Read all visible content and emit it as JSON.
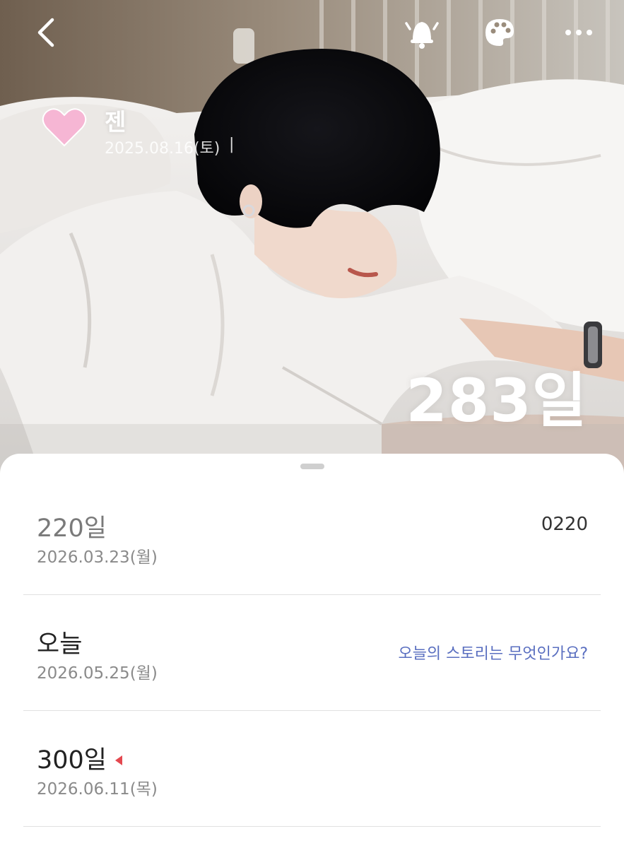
{
  "header": {
    "back_icon": "chevron-left-icon",
    "bell_icon": "bell-icon",
    "palette_icon": "palette-icon",
    "more_icon": "more-horizontal-icon"
  },
  "profile": {
    "icon": "heart-icon",
    "heart_color": "#f6b6d4",
    "name": "젠",
    "start_date": "2025.08.16(토)",
    "separator": "|"
  },
  "day_count": "283일",
  "events": [
    {
      "title": "220일",
      "date": "2026.03.23(월)",
      "right_text": "0220"
    },
    {
      "title": "오늘",
      "date": "2026.05.25(월)",
      "link_text": "오늘의 스토리는 무엇인가요?"
    },
    {
      "title": "300일",
      "date": "2026.06.11(목)",
      "marker_icon": "triangle-left-icon",
      "marker_color": "#e4484f"
    }
  ],
  "colors": {
    "link": "#5a6fc0",
    "white": "#ffffff"
  }
}
